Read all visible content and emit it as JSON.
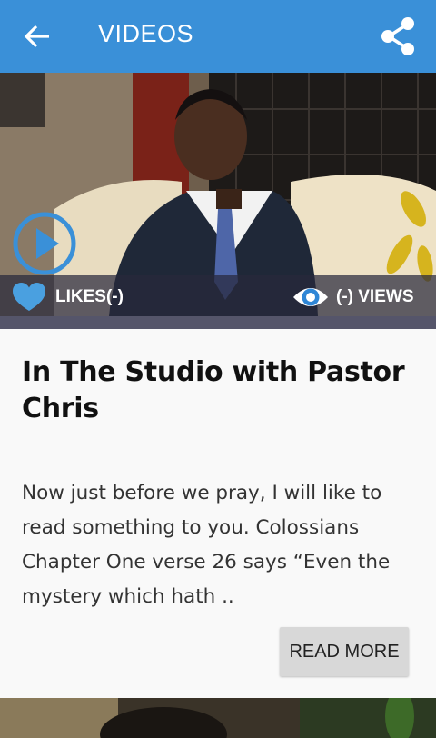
{
  "appbar": {
    "title": "VIDEOS",
    "back_icon": "arrow-left-icon",
    "share_icon": "share-icon",
    "color": "#3a90d8"
  },
  "video_card": {
    "likes_label": "LIKES(-)",
    "views_label": "(-) VIEWS",
    "title": "In The Studio with Pastor Chris",
    "excerpt": "Now just before we pray, I will like to read something to you. Colossians Chapter One verse 26 says “Even the mystery which hath ..",
    "read_more_label": "READ MORE",
    "play_icon": "play-icon",
    "likes_icon": "heart-icon",
    "views_icon": "eye-icon",
    "accent": "#3a90d8"
  }
}
